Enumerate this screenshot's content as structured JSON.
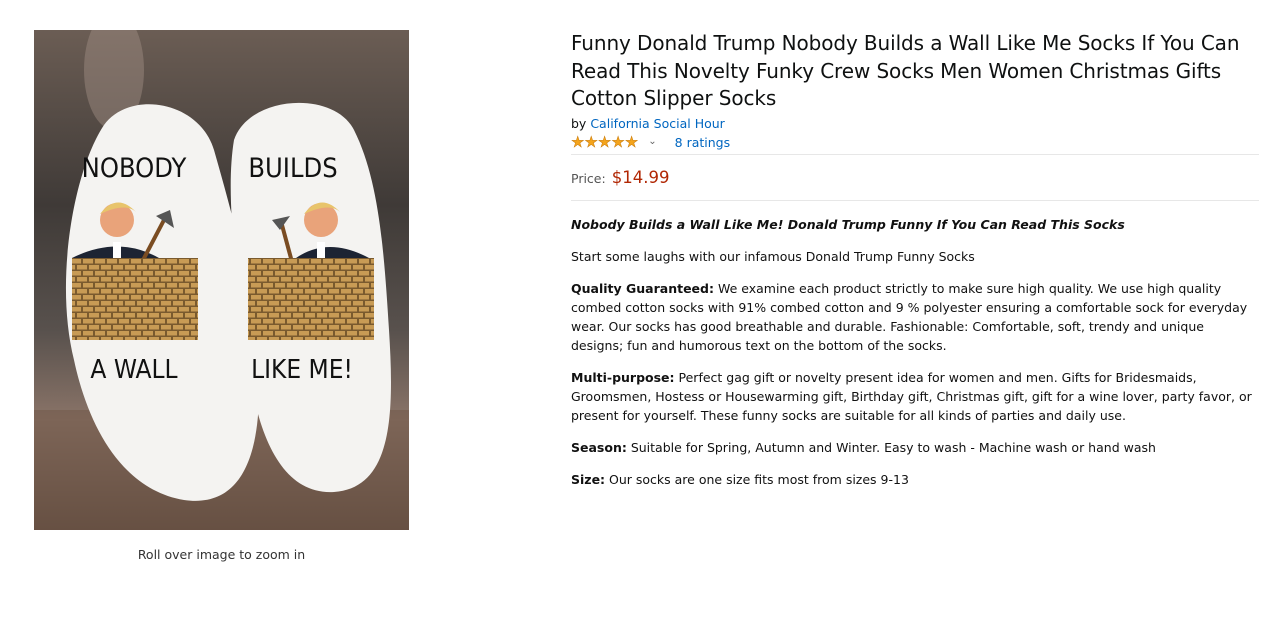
{
  "image": {
    "caption": "Roll over image to zoom in",
    "left_sock_text_top": "NOBODY",
    "right_sock_text_top": "BUILDS",
    "left_sock_text_bottom": "A WALL",
    "right_sock_text_bottom": "LIKE ME!"
  },
  "product": {
    "title": "Funny Donald Trump Nobody Builds a Wall Like Me Socks If You Can Read This Novelty Funky Crew Socks Men Women Christmas Gifts Cotton Slipper Socks",
    "by_prefix": "by",
    "brand": "California Social Hour",
    "rating_stars": 5,
    "ratings_count": "8 ratings",
    "price_label": "Price:",
    "price": "$14.99"
  },
  "description": {
    "headline": "Nobody Builds a Wall Like Me! Donald Trump Funny If You Can Read This Socks",
    "intro": "Start some laughs with our infamous Donald Trump Funny Socks",
    "bullets": [
      {
        "label": "Quality Guaranteed:",
        "text": " We examine each product strictly to make sure high quality. We use high quality combed cotton socks with 91% combed cotton and 9 % polyester ensuring a comfortable sock for everyday wear. Our socks has good breathable and durable. Fashionable: Comfortable, soft, trendy and unique designs; fun and humorous text on the bottom of the socks."
      },
      {
        "label": "Multi-purpose:",
        "text": " Perfect gag gift or novelty present idea for women and men. Gifts for Bridesmaids, Groomsmen, Hostess or Housewarming gift, Birthday gift, Christmas gift, gift for a wine lover, party favor, or present for yourself. These funny socks are suitable for all kinds of parties and daily use."
      },
      {
        "label": "Season:",
        "text": " Suitable for Spring, Autumn and Winter. Easy to wash - Machine wash or hand wash"
      },
      {
        "label": "Size:",
        "text": " Our socks are one size fits most from sizes 9-13"
      }
    ]
  },
  "colors": {
    "link": "#0066c0",
    "price": "#b12704",
    "star": "#f4a41c"
  }
}
